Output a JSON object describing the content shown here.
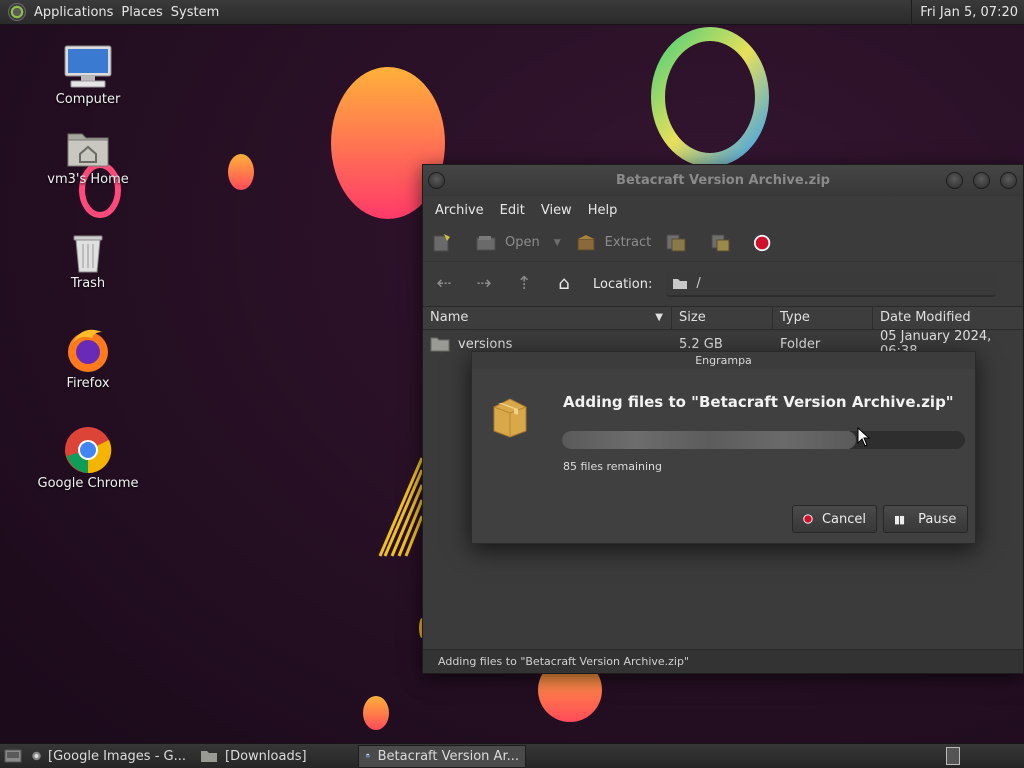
{
  "top_panel": {
    "menus": [
      "Applications",
      "Places",
      "System"
    ],
    "clock": "Fri Jan  5, 07:20"
  },
  "desktop": {
    "icons": [
      {
        "label": "Computer",
        "icon": "computer-icon"
      },
      {
        "label": "vm3's Home",
        "icon": "home-folder-icon"
      },
      {
        "label": "Trash",
        "icon": "trash-icon"
      },
      {
        "label": "Firefox",
        "icon": "firefox-icon"
      },
      {
        "label": "Google Chrome",
        "icon": "chrome-icon"
      }
    ]
  },
  "window": {
    "title": "Betacraft Version Archive.zip",
    "menus": [
      "Archive",
      "Edit",
      "View",
      "Help"
    ],
    "toolbar": {
      "open_label": "Open",
      "extract_label": "Extract"
    },
    "location": {
      "label": "Location:",
      "value": "/"
    },
    "columns": [
      "Name",
      "Size",
      "Type",
      "Date Modified"
    ],
    "rows": [
      {
        "name": "versions",
        "size": "5.2 GB",
        "type": "Folder",
        "date": "05 January 2024, 06:38"
      }
    ],
    "status": "Adding files to \"Betacraft Version Archive.zip\""
  },
  "dialog": {
    "title": "Engrampa",
    "heading": "Adding files to \"Betacraft Version Archive.zip\"",
    "progress": 0.73,
    "remaining": "85 files remaining",
    "cancel_label": "Cancel",
    "pause_label": "Pause"
  },
  "taskbar": {
    "tasks": [
      {
        "label": "[Google Images - G...",
        "icon": "chrome-icon"
      },
      {
        "label": "[Downloads]",
        "icon": "folder-icon"
      },
      {
        "label": "Betacraft Version Ar...",
        "icon": "archive-icon"
      }
    ]
  },
  "colors": {
    "accent_red": "#d0102a",
    "window_bg": "#3b3b3b"
  }
}
